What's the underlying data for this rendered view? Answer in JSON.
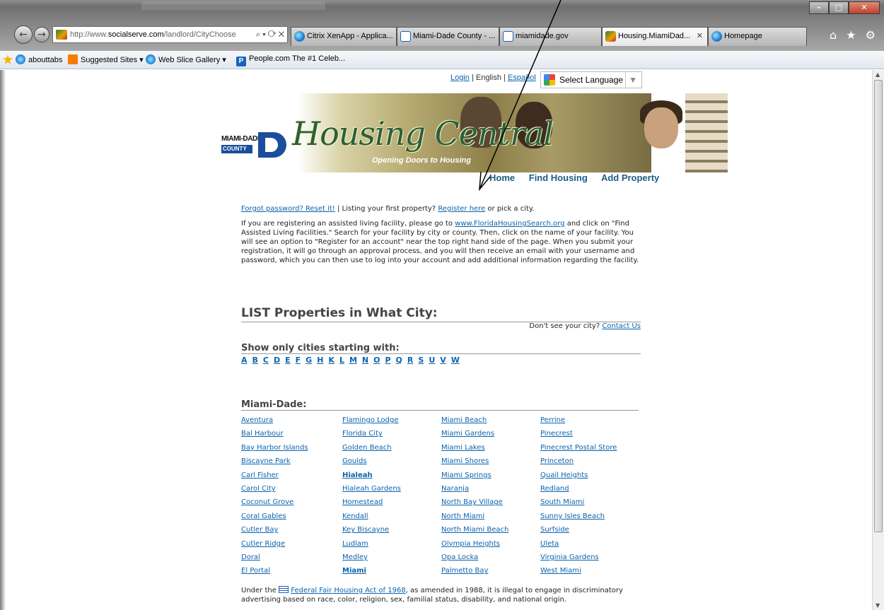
{
  "browser": {
    "address_prefix": "http://www.",
    "address_domain": "socialserve.com",
    "address_path": "/landlord/CityChoose",
    "address_controls": "⌕ ▾ ⟳ ✕",
    "tabs": [
      {
        "label": "Citrix XenApp - Applica...",
        "icon": "ie-icon"
      },
      {
        "label": "Miami-Dade County - ...",
        "icon": "page-icon"
      },
      {
        "label": "miamidade.gov",
        "icon": "page-icon"
      },
      {
        "label": "Housing.MiamiDad...",
        "icon": "mdc-icon"
      },
      {
        "label": "Homepage",
        "icon": "ie-icon"
      }
    ],
    "active_tab_close": "✕",
    "right_controls": "⌂ ★ ⚙"
  },
  "favorites": [
    {
      "label": "abouttabs",
      "icon": "ie-icon"
    },
    {
      "label": "Suggested Sites ▾",
      "icon": "orange-icon"
    },
    {
      "label": "Web Slice Gallery ▾",
      "icon": "ie-icon"
    },
    {
      "label": "People.com  The #1 Celeb...",
      "icon": "people-icon"
    }
  ],
  "lang": {
    "login": "Login",
    "sep1": " | ",
    "english": "English",
    "sep2": " | ",
    "espanol": "Español",
    "select_language": "Select Language"
  },
  "banner": {
    "county_top": "MIAMI-DADE",
    "county_bottom": "COUNTY",
    "title": "Housing Central",
    "slogan": "Opening Doors to Housing"
  },
  "nav": {
    "home": "Home",
    "find": "Find Housing",
    "add": "Add Property"
  },
  "intro": {
    "forgot": "Forgot password? Reset it!",
    "sep": "  |  Listing your first property? ",
    "register": "Register here",
    "tail": " or pick a city."
  },
  "assisted": {
    "pre": "If you are registering an assisted living facility, please go to ",
    "link": "www.FloridaHousingSearch.org",
    "post": " and click on \"Find Assisted Living Facilities.\" Search for your facility by city or county. Then, click on the name of your facility. You will see an option to \"Register for an account\" near the top right hand side of the page. When you submit your registration, it will go through an approval process, and you will then receive an email with your username and password, which you can then use to log into your account and add additional information regarding the facility."
  },
  "list_heading": "LIST Properties in What City:",
  "dont_see": "Don't see your city? ",
  "contact_us": "Contact Us",
  "show_only": "Show only cities starting with:",
  "letters": [
    "A",
    "B",
    "C",
    "D",
    "E",
    "F",
    "G",
    "H",
    "K",
    "L",
    "M",
    "N",
    "O",
    "P",
    "Q",
    "R",
    "S",
    "U",
    "V",
    "W"
  ],
  "county_heading": "Miami-Dade:",
  "cities": [
    [
      "Aventura",
      "Bal Harbour",
      "Bay Harbor Islands",
      "Biscayne Park",
      "Carl Fisher",
      "Carol City",
      "Coconut Grove",
      "Coral Gables",
      "Cutler Bay",
      "Cutler Ridge",
      "Doral",
      "El Portal"
    ],
    [
      "Flamingo Lodge",
      "Florida City",
      "Golden Beach",
      "Goulds",
      "Hialeah",
      "Hialeah Gardens",
      "Homestead",
      "Kendall",
      "Key Biscayne",
      "Ludlam",
      "Medley",
      "Miami"
    ],
    [
      "Miami Beach",
      "Miami Gardens",
      "Miami Lakes",
      "Miami Shores",
      "Miami Springs",
      "Naranja",
      "North Bay Village",
      "North Miami",
      "North Miami Beach",
      "Olympia Heights",
      "Opa Locka",
      "Palmetto Bay"
    ],
    [
      "Perrine",
      "Pinecrest",
      "Pinecrest Postal Store",
      "Princeton",
      "Quail Heights",
      "Redland",
      "South Miami",
      "Sunny Isles Beach",
      "Surfside",
      "Uleta",
      "Virginia Gardens",
      "West Miami"
    ]
  ],
  "bold_cities": [
    "Hialeah",
    "Miami"
  ],
  "fair_housing": {
    "pre": "Under the ",
    "link": "Federal Fair Housing Act of 1968",
    "post": ", as amended in 1988, it is illegal to engage in discriminatory advertising based on race, color, religion, sex, familial status, disability, and national origin."
  },
  "colors": {
    "link": "#0b63ad",
    "nav": "#1c5b86",
    "brand_green": "#2d5f38",
    "brand_blue": "#1a4e9c"
  }
}
